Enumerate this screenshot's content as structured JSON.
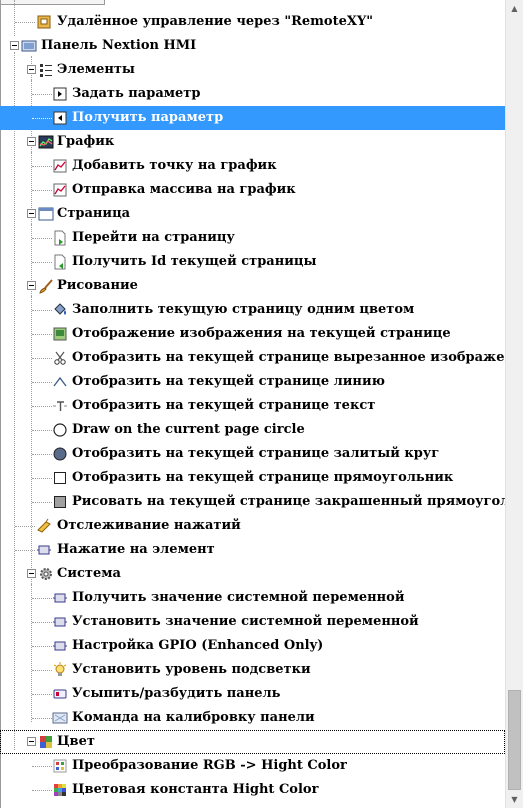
{
  "tree": {
    "remotexy": "Удалённое управление через \"RemoteXY\"",
    "nextion": "Панель Nextion HMI",
    "elements": "Элементы",
    "set_param": "Задать параметр",
    "get_param": "Получить параметр",
    "graph": "График",
    "add_point": "Добавить точку на график",
    "send_array": "Отправка массива на график",
    "page": "Страница",
    "goto_page": "Перейти на страницу",
    "get_page_id": "Получить Id текущей страницы",
    "drawing": "Рисование",
    "fill_page": "Заполнить текущую страницу одним цветом",
    "show_image": "Отображение изображения на текущей странице",
    "crop_image": "Отобразить на текущей странице вырезанное изображение",
    "line": "Отобразить на текущей странице линию",
    "text": "Отобразить на текущей странице текст",
    "circle": "Draw on the current page circle",
    "filled_circle": "Отобразить на текущей странице залитый круг",
    "rect": "Отобразить на текущей странице прямоугольник",
    "filled_rect": "Рисовать на текущей странице закрашенный прямоугольник",
    "touch": "Отслеживание нажатий",
    "press_element": "Нажатие на элемент",
    "system": "Система",
    "get_sysvar": "Получить значение системной переменной",
    "set_sysvar": "Установить значение системной переменной",
    "gpio": "Настройка GPIO  (Enhanced Only)",
    "backlight": "Установить уровень подсветки",
    "sleep": "Усыпить/разбудить панель",
    "calibrate": "Команда на калибровку панели",
    "color": "Цвет",
    "rgb": "Преобразование RGB -> Hight Color",
    "color_const": "Цветовая константа Hight Color"
  },
  "colors": {
    "selection": "#3399ff"
  }
}
